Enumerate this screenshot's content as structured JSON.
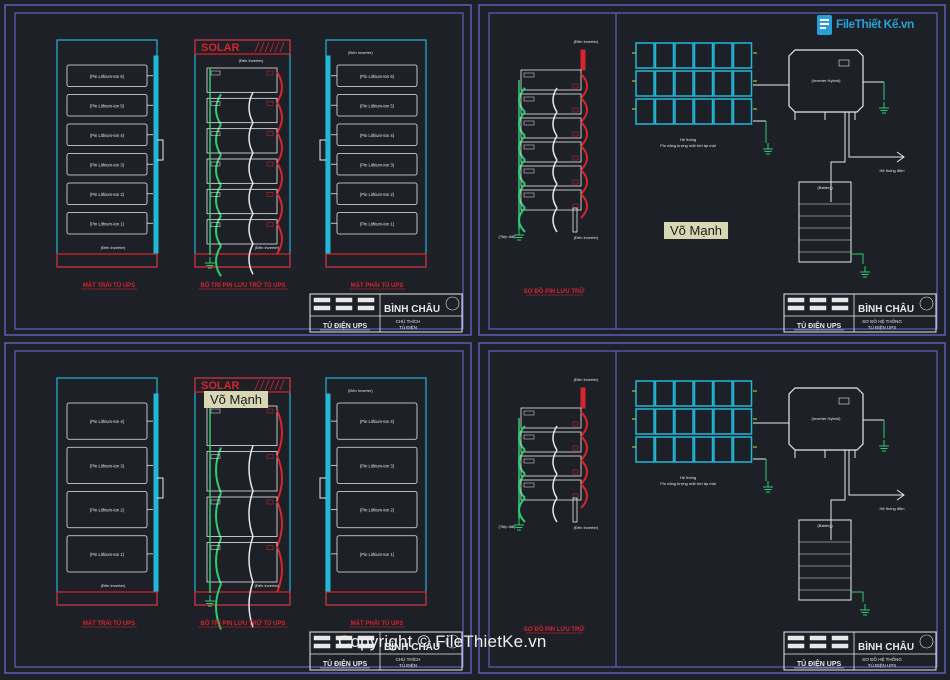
{
  "logo": {
    "text": "FileThiết Kế",
    "suffix": ".vn"
  },
  "watermark": "Copyright © FileThietKe.vn",
  "author_badge": "Võ Mạnh",
  "colors": {
    "bg": "#1d2027",
    "frame": "#6b6fd6",
    "cyan": "#22b7d6",
    "red": "#d8242c",
    "green": "#2ecc71",
    "white": "#e8e8e8",
    "dim": "#9a9a9a"
  },
  "cabinet_sheet": {
    "left_title": "MẶT TRÁI TỦ UPS",
    "middle_title": "BỐ TRÍ PIN LƯU TRỮ TỦ UPS",
    "right_title": "MẶT PHẢI TỦ UPS",
    "solar_label": "SOLAR",
    "inverter_label": "(Đến Inverter)",
    "cells_6": [
      "(Pin Lithium-Ion 6)",
      "(Pin Lithium-Ion 5)",
      "(Pin Lithium-Ion 4)",
      "(Pin Lithium-Ion 3)",
      "(Pin Lithium-Ion 2)",
      "(Pin Lithium-Ion 1)"
    ],
    "cells_4": [
      "(Pin Lithium-Ion 4)",
      "(Pin Lithium-Ion 3)",
      "(Pin Lithium-Ion 2)",
      "(Pin Lithium-Ion 1)"
    ],
    "title_block": {
      "company": "BÌNH CHÂU",
      "drawing": "TỦ ĐIỆN UPS",
      "note1": "CHÚ THÍCH",
      "note2": "TỦ ĐIỆN"
    }
  },
  "system_sheet": {
    "battery_diagram_title": "SƠ ĐỒ PIN LƯU TRỮ",
    "to_inverter": "(Đến Inverter)",
    "ground": "(Tiếp đất)",
    "inverter": "(Inverter Hybrid)",
    "battery": "(Battery)",
    "pv_label_1": "Hệ thống",
    "pv_label_2": "Pin năng lượng mặt trời áp mái",
    "grid": "Hệ thống điện",
    "title_block": {
      "company": "BÌNH CHÂU",
      "drawing": "TỦ ĐIỆN UPS",
      "note1": "SƠ ĐỒ HỆ THỐNG",
      "note2": "TỦ ĐIỆN UPS"
    }
  }
}
